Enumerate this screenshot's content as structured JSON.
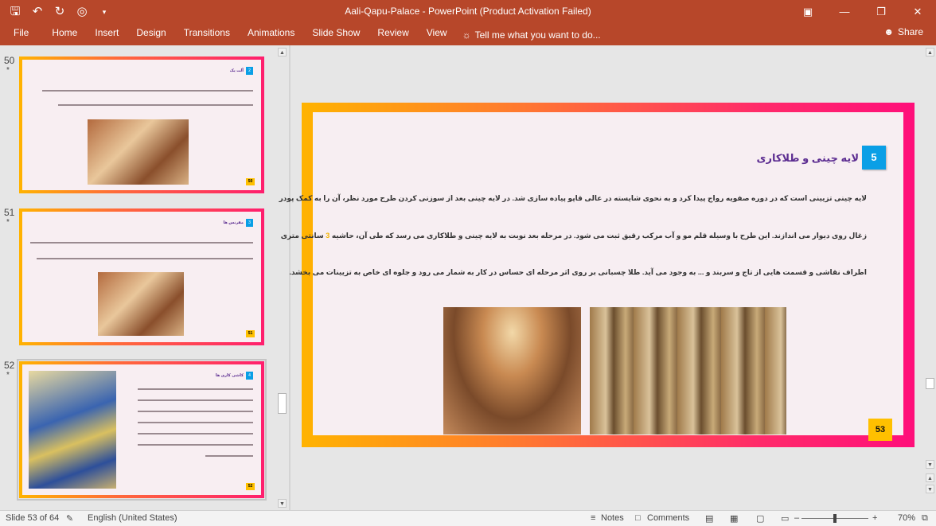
{
  "window": {
    "title": "Aali-Qapu-Palace - PowerPoint (Product Activation Failed)",
    "icons": {
      "save": "save-icon",
      "undo": "undo-icon",
      "redo": "redo-icon",
      "present": "present-icon",
      "customize": "customize-qat-icon"
    }
  },
  "ribbon": {
    "file": "File",
    "tabs": [
      "Home",
      "Insert",
      "Design",
      "Transitions",
      "Animations",
      "Slide Show",
      "Review",
      "View"
    ],
    "tell_me": "Tell me what you want to do...",
    "share": "Share"
  },
  "thumbnails": [
    {
      "number": "50",
      "star": "*",
      "title": "آلت یک",
      "badge": "2",
      "page": "50"
    },
    {
      "number": "51",
      "star": "*",
      "title": "مقرنس ها",
      "badge": "3",
      "page": "51"
    },
    {
      "number": "52",
      "star": "*",
      "title": "کاشی کاری ها",
      "badge": "4",
      "page": "52"
    }
  ],
  "slide": {
    "title": "لایه چینی و طلاکاری",
    "badge": "5",
    "para1": "لایه چینی تزیینی است که در دوره صفویه رواج پیدا کرد و به نحوی شایسته در عالی قاپو پیاده سازی شد. در لایه چینی بعد از سوزنی کردن طرح مورد نظر، آن را به کمک پودر",
    "para2a": "زغال روی دیوار می اندازند. این طرح با وسیله قلم مو و آب مرکب رقیق ثبت می شود. در مرحله بعد نوبت به لایه چینی و طلاکاری می رسد که طی آن، حاشیه",
    "para2_hl": "3",
    "para2b": "سانتی متری",
    "para3": "اطراف نقاشی و قسمت هایی از تاج و سربند و ... به وجود می آید. طلا چسبانی بر روی اثر مرحله ای حساس در کار به شمار می رود و جلوه ای خاص به تزیینات می بخشد.",
    "page": "53"
  },
  "status": {
    "slide_info": "Slide 53 of 64",
    "language": "English (United States)",
    "notes": "Notes",
    "comments": "Comments",
    "zoom": "70%"
  }
}
